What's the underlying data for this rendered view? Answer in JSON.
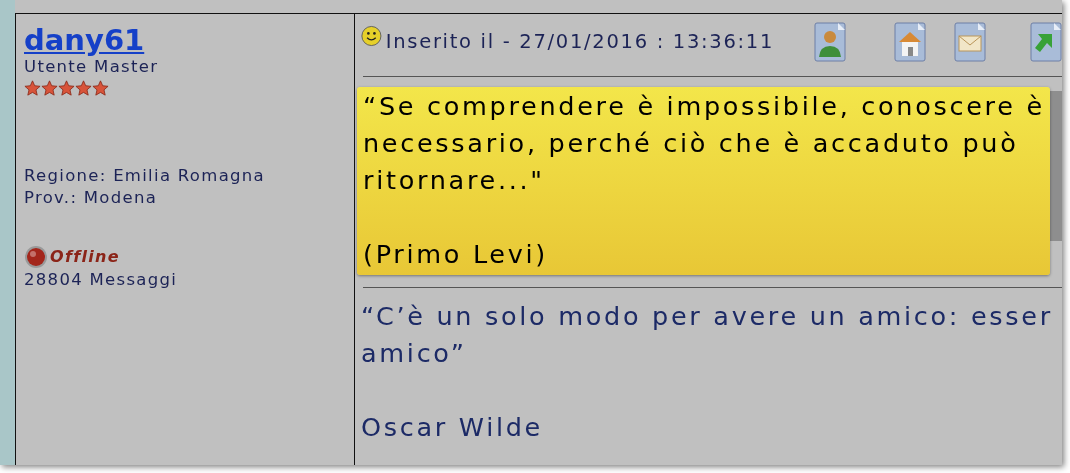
{
  "user": {
    "name": "dany61",
    "rank": "Utente Master",
    "stars": 5,
    "details": [
      "Regione: Emilia Romagna",
      "Prov.: Modena"
    ],
    "online": false,
    "status": "Offline",
    "posts": "28804 Messaggi"
  },
  "post": {
    "posted": "Inserito il - 27/01/2016 : 13:36:11",
    "actions": [
      {
        "kind": "profile"
      },
      {
        "kind": "home"
      },
      {
        "kind": "email"
      },
      {
        "kind": "arrow"
      }
    ],
    "highlight": {
      "lines": [
        "“Se comprendere è impossibile, conoscere è",
        "necessario, perché ciò che è accaduto può",
        "ritornare...\""
      ],
      "author": "(Primo Levi)"
    },
    "quote": {
      "lines": [
        "“C’è un solo modo per avere un amico: esser",
        "amico”"
      ],
      "author": "Oscar Wilde"
    }
  }
}
